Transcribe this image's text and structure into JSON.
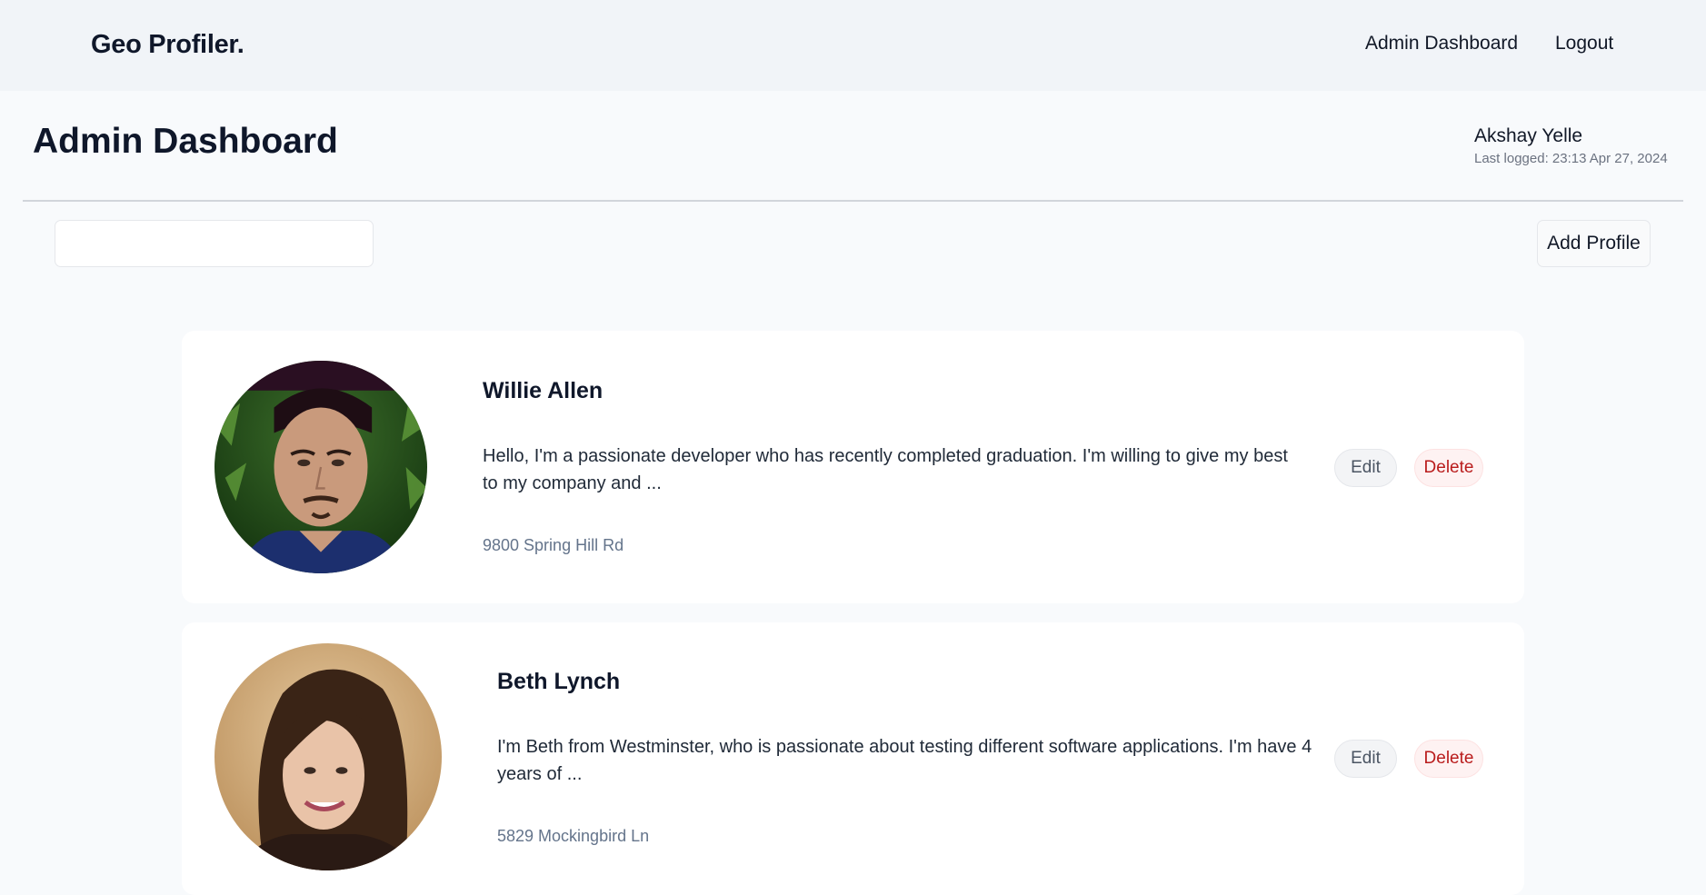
{
  "header": {
    "brand": "Geo Profiler.",
    "nav": {
      "admin_dashboard": "Admin Dashboard",
      "logout": "Logout"
    }
  },
  "page": {
    "title": "Admin Dashboard",
    "user": {
      "name": "Akshay Yelle",
      "last_logged": "Last logged: 23:13 Apr 27, 2024"
    }
  },
  "toolbar": {
    "search_value": "",
    "add_profile_label": "Add Profile"
  },
  "profiles": [
    {
      "name": "Willie Allen",
      "bio": "Hello, I'm a passionate developer who has recently completed graduation. I'm willing to give my best to my company and ...",
      "address": "9800 Spring Hill Rd",
      "edit_label": "Edit",
      "delete_label": "Delete",
      "avatar": "man-portrait-photo"
    },
    {
      "name": "Beth Lynch",
      "bio": "I'm Beth from Westminster, who is passionate about testing different software applications. I'm have 4 years of ...",
      "address": "5829 Mockingbird Ln",
      "edit_label": "Edit",
      "delete_label": "Delete",
      "avatar": "woman-portrait-photo"
    }
  ],
  "colors": {
    "navbar_bg": "#f1f4f8",
    "page_bg": "#f8fafc",
    "card_bg": "#ffffff",
    "delete_text": "#b91c1c",
    "address_text": "#64748b"
  }
}
